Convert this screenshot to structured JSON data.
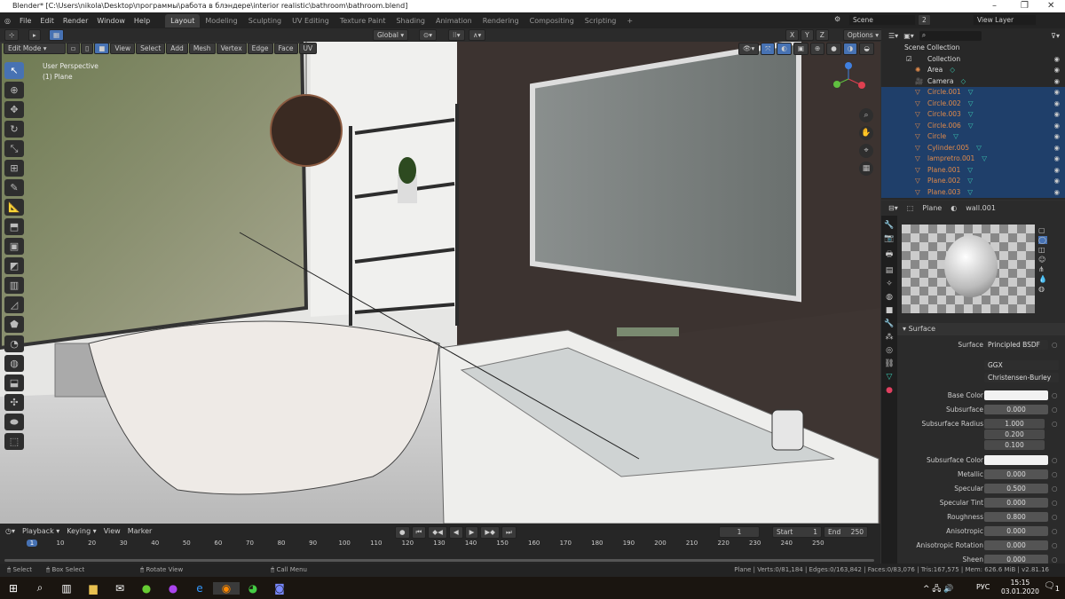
{
  "window": {
    "title": "Blender* [C:\\Users\\nikola\\Desktop\\программы\\работа в блэндере\\interior realistic\\bathroom\\bathroom.blend]"
  },
  "menu": [
    "File",
    "Edit",
    "Render",
    "Window",
    "Help"
  ],
  "workspaces": [
    "Layout",
    "Modeling",
    "Sculpting",
    "UV Editing",
    "Texture Paint",
    "Shading",
    "Animation",
    "Rendering",
    "Compositing",
    "Scripting"
  ],
  "scene": {
    "name": "Scene",
    "users": "2",
    "view_layer": "View Layer"
  },
  "tool_header": {
    "transform_orientation": "Global",
    "options_label": "Options",
    "axes": [
      "X",
      "Y",
      "Z"
    ]
  },
  "viewport": {
    "mode": "Edit Mode",
    "menus": [
      "View",
      "Select",
      "Add",
      "Mesh",
      "Vertex",
      "Edge",
      "Face",
      "UV"
    ],
    "info_line1": "User Perspective",
    "info_line2": "(1) Plane"
  },
  "outliner": {
    "root": "Scene Collection",
    "collection": "Collection",
    "items": [
      {
        "name": "Area",
        "selected": false
      },
      {
        "name": "Camera",
        "selected": false
      },
      {
        "name": "Circle.001",
        "selected": true
      },
      {
        "name": "Circle.002",
        "selected": true
      },
      {
        "name": "Circle.003",
        "selected": true
      },
      {
        "name": "Circle.006",
        "selected": true
      },
      {
        "name": "Circle",
        "selected": true
      },
      {
        "name": "Cylinder.005",
        "selected": true
      },
      {
        "name": "lampretro.001",
        "selected": true
      },
      {
        "name": "Plane.001",
        "selected": true
      },
      {
        "name": "Plane.002",
        "selected": true
      },
      {
        "name": "Plane.003",
        "selected": true
      }
    ]
  },
  "properties": {
    "object": "Plane",
    "material": "wall.001",
    "section": "Surface",
    "surface_label": "Surface",
    "surface_value": "Principled BSDF",
    "distribution": "GGX",
    "subsurface_method": "Christensen-Burley",
    "rows": [
      {
        "label": "Base Color",
        "type": "color",
        "value": ""
      },
      {
        "label": "Subsurface",
        "value": "0.000",
        "fill": 0
      },
      {
        "label": "Subsurface Radius",
        "value": "1.000",
        "fill": 0
      },
      {
        "label": "",
        "value": "0.200",
        "fill": 0
      },
      {
        "label": "",
        "value": "0.100",
        "fill": 0
      },
      {
        "label": "Subsurface Color",
        "type": "color",
        "value": ""
      },
      {
        "label": "Metallic",
        "value": "0.000",
        "fill": 0
      },
      {
        "label": "Specular",
        "value": "0.500",
        "fill": 0.5
      },
      {
        "label": "Specular Tint",
        "value": "0.000",
        "fill": 0
      },
      {
        "label": "Roughness",
        "value": "0.800",
        "fill": 0.8
      },
      {
        "label": "Anisotropic",
        "value": "0.000",
        "fill": 0
      },
      {
        "label": "Anisotropic Rotation",
        "value": "0.000",
        "fill": 0
      },
      {
        "label": "Sheen",
        "value": "0.000",
        "fill": 0
      }
    ]
  },
  "timeline": {
    "menus": [
      "Playback",
      "Keying",
      "View",
      "Marker"
    ],
    "current_frame": "1",
    "start_label": "Start",
    "start": "1",
    "end_label": "End",
    "end": "250",
    "ticks": [
      "1",
      "10",
      "20",
      "30",
      "40",
      "50",
      "60",
      "70",
      "80",
      "90",
      "100",
      "110",
      "120",
      "130",
      "140",
      "150",
      "160",
      "170",
      "180",
      "190",
      "200",
      "210",
      "220",
      "230",
      "240",
      "250"
    ]
  },
  "status": {
    "select": "Select",
    "box_select": "Box Select",
    "rotate": "Rotate View",
    "call_menu": "Call Menu",
    "stats": "Plane | Verts:0/81,184 | Edges:0/163,842 | Faces:0/83,076 | Tris:167,575 | Mem: 626.6 MiB | v2.81.16"
  },
  "taskbar": {
    "lang": "РУС",
    "time": "15:15",
    "date": "03.01.2020",
    "notifications": "1"
  },
  "colors": {
    "accent": "#4772b3",
    "selected_row": "#1f3f6a",
    "object_name": "#e08a4a"
  }
}
